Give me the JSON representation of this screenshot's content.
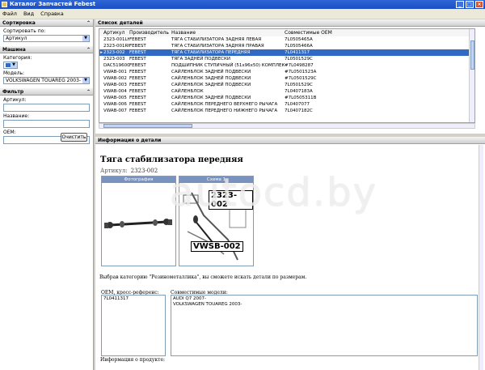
{
  "window": {
    "title": "Каталог Запчастей Febest"
  },
  "menu": [
    "Файл",
    "Вид",
    "Справка"
  ],
  "sidebar": {
    "sort": {
      "header": "Сортировка",
      "label": "Сортировать по:",
      "value": "Артикул"
    },
    "machine": {
      "header": "Машина",
      "category_label": "Категория:",
      "category_value": "",
      "model_label": "Модель:",
      "model_value": "VOLKSWAGEN TOUAREG 2003-"
    },
    "filter": {
      "header": "Фильтр",
      "article_label": "Артикул:",
      "name_label": "Название:",
      "oem_label": "OEM:",
      "clear_button": "Очистить"
    }
  },
  "list": {
    "header": "Список деталей",
    "columns": [
      "Артикул",
      "Производитель",
      "Название",
      "Совместимые OEM"
    ],
    "rows": [
      [
        "2323-001LH",
        "FEBEST",
        "ТЯГА СТАБИЛИЗАТОРА ЗАДНЯЯ ЛЕВАЯ",
        "7L0505465A"
      ],
      [
        "2323-001RH",
        "FEBEST",
        "ТЯГА СТАБИЛИЗАТОРА ЗАДНЯЯ ПРАВАЯ",
        "7L0505466A"
      ],
      [
        "2323-002",
        "FEBEST",
        "ТЯГА СТАБИЛИЗАТОРА ПЕРЕДНЯЯ",
        "7L0411317"
      ],
      [
        "2323-003",
        "FEBEST",
        "ТЯГА ЗАДНЕЙ ПОДВЕСКИ",
        "7L0501529C"
      ],
      [
        "DAC51960010",
        "FEBEST",
        "ПОДШИПНИК СТУПИЧНЫЙ (51x96x50) КОМПЛЕКТ",
        "#7L0498287"
      ],
      [
        "VWAB-001",
        "FEBEST",
        "САЙЛЕНБЛОК ЗАДНЕЙ ПОДВЕСКИ",
        "#7L0501523A"
      ],
      [
        "VWAB-002",
        "FEBEST",
        "САЙЛЕНБЛОК ЗАДНЕЙ ПОДВЕСКИ",
        "#7L0501529C"
      ],
      [
        "VWAB-003",
        "FEBEST",
        "САЙЛЕНБЛОК ЗАДНЕЙ ПОДВЕСКИ",
        "7L0501529C"
      ],
      [
        "VWAB-004",
        "FEBEST",
        "САЙЛЕНБЛОК",
        "7L0407183A"
      ],
      [
        "VWAB-005",
        "FEBEST",
        "САЙЛЕНБЛОК ЗАДНЕЙ ПОДВЕСКИ",
        "#7L0505311B"
      ],
      [
        "VWAB-006",
        "FEBEST",
        "САЙЛЕНБЛОК ПЕРЕДНЕГО ВЕРХНЕГО РЫЧАГА",
        "7L0407077"
      ],
      [
        "VWAB-007",
        "FEBEST",
        "САЙЛЕНБЛОК ПЕРЕДНЕГО НИЖНЕГО РЫЧАГА",
        "7L0407182C"
      ]
    ],
    "selected_index": 2
  },
  "info": {
    "header": "Информация о детали",
    "title": "Тяга стабилизатора передняя",
    "article_label": "Артикул:",
    "article": "2323-002",
    "photo_label": "Фотография",
    "scheme_label": "Схема 1",
    "scheme_part_label": "2323-002",
    "scheme_sub_label": "VWSB-002",
    "note": "Выбрав категорию \"Резинометаллика\", вы сможете искать детали по размерам.",
    "oem_label": "OEM, кросс-референс:",
    "oem_value": "7L0411317",
    "compat_label": "Совместимые модели:",
    "compat_models": [
      "AUDI Q7 2007-",
      "VOLKSWAGEN TOUAREG 2003-"
    ],
    "product_info_label": "Информация о продукте:"
  },
  "watermark": "autocd.by"
}
